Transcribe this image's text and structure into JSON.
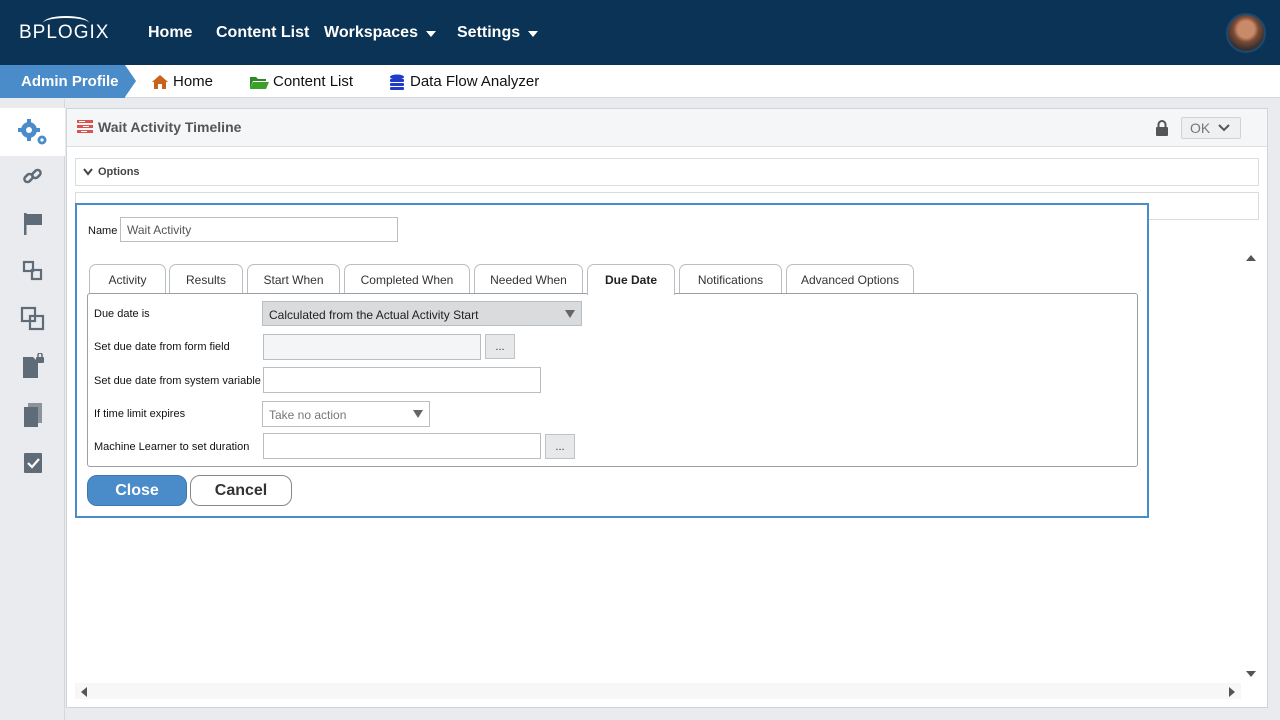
{
  "brand": {
    "logo_text": "BPLOGIX"
  },
  "topnav": {
    "home": "Home",
    "content_list": "Content List",
    "workspaces": "Workspaces",
    "settings": "Settings"
  },
  "breadcrumb": {
    "admin_profile": "Admin Profile",
    "home": "Home",
    "content_list": "Content List",
    "data_flow": "Data Flow Analyzer"
  },
  "sidebar": {
    "items": [
      "gears-icon",
      "link-icon",
      "flag-icon",
      "diagram-icon",
      "overlap-icon",
      "locked-document-icon",
      "copy-icon",
      "checklist-icon"
    ]
  },
  "panel": {
    "title": "Wait Activity Timeline",
    "ok_label": "OK",
    "options_label": "Options"
  },
  "dialog": {
    "name_label": "Name",
    "name_value": "Wait Activity",
    "tabs": [
      "Activity",
      "Results",
      "Start When",
      "Completed When",
      "Needed When",
      "Due Date",
      "Notifications",
      "Advanced Options"
    ],
    "active_tab": "Due Date",
    "fields": {
      "due_date_label": "Due date is",
      "due_date_value": "Calculated from the Actual Activity Start",
      "form_field_label": "Set due date from form field",
      "system_var_label": "Set due date from system variable",
      "time_limit_label": "If time limit expires",
      "time_limit_value": "Take no action",
      "ml_label": "Machine Learner to set duration",
      "dots": "..."
    },
    "close_label": "Close",
    "cancel_label": "Cancel"
  },
  "colors": {
    "nav_bg": "#0b3355",
    "accent": "#4a8bc9",
    "home_icon": "#c9621a",
    "folder_icon": "#3aa02a",
    "db_icon": "#1f3cc8"
  }
}
